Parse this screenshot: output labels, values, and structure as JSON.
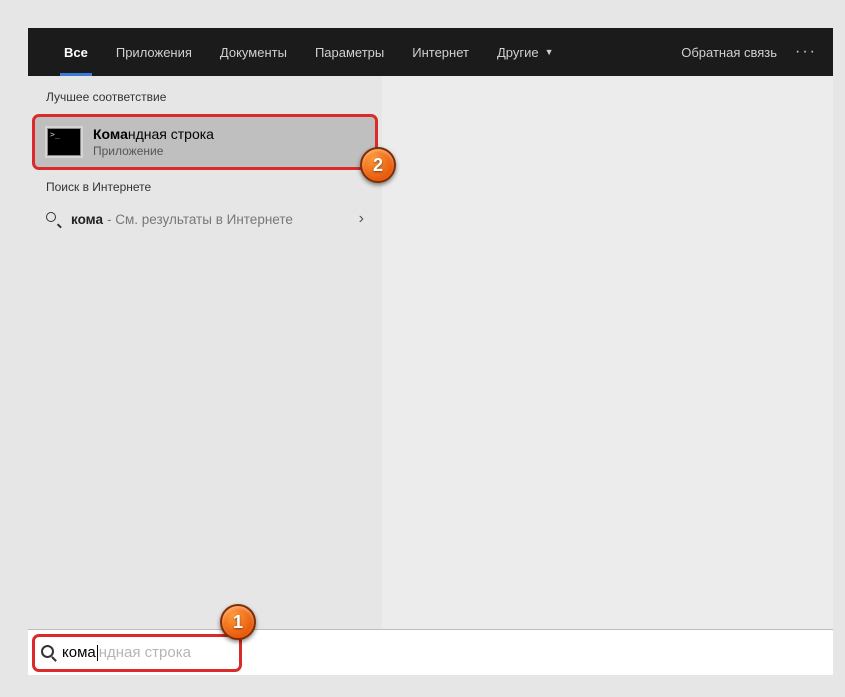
{
  "topbar": {
    "tabs": {
      "all": "Все",
      "apps": "Приложения",
      "docs": "Документы",
      "params": "Параметры",
      "internet": "Интернет",
      "other": "Другие"
    },
    "feedback": "Обратная связь"
  },
  "sections": {
    "best_match": "Лучшее соответствие",
    "web_search": "Поиск в Интернете"
  },
  "best_result": {
    "title_bold": "Кома",
    "title_rest": "ндная строка",
    "subtitle": "Приложение"
  },
  "web_result": {
    "query_bold": "кома",
    "hint": "- См. результаты в Интернете"
  },
  "search": {
    "typed": "кома",
    "completion": "ндная строка"
  },
  "badges": {
    "one": "1",
    "two": "2"
  }
}
